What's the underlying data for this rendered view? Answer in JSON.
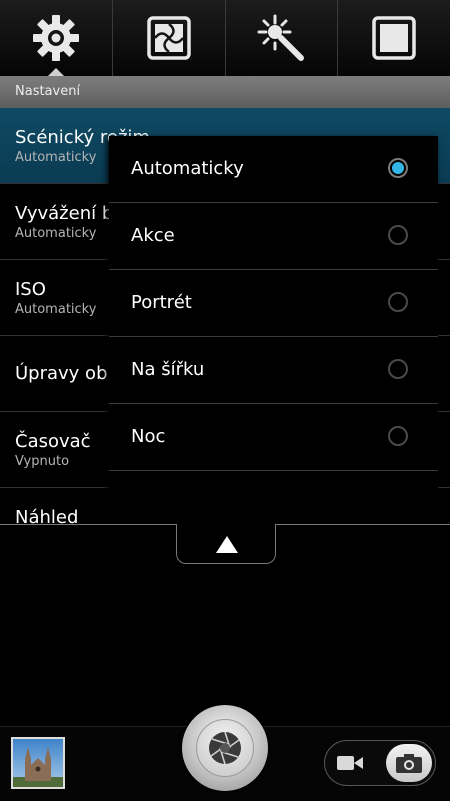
{
  "tabs": [
    {
      "icon": "gear-icon",
      "active": true
    },
    {
      "icon": "effects-grid-icon",
      "active": false
    },
    {
      "icon": "magic-wand-icon",
      "active": false
    },
    {
      "icon": "square-icon",
      "active": false
    }
  ],
  "section_header": "Nastavení",
  "settings": [
    {
      "title": "Scénický režim",
      "value": "Automaticky"
    },
    {
      "title": "Vyvážení bílé",
      "value": "Automaticky"
    },
    {
      "title": "ISO",
      "value": "Automaticky"
    },
    {
      "title": "Úpravy obrázku",
      "value": ""
    },
    {
      "title": "Časovač",
      "value": "Vypnuto"
    },
    {
      "title": "Náhled",
      "value": ""
    }
  ],
  "dropdown": {
    "options": [
      {
        "label": "Automaticky",
        "checked": true
      },
      {
        "label": "Akce",
        "checked": false
      },
      {
        "label": "Portrét",
        "checked": false
      },
      {
        "label": "Na šířku",
        "checked": false
      },
      {
        "label": "Noc",
        "checked": false
      }
    ]
  },
  "bottom_bar": {
    "thumbnail": "gallery-thumbnail-icon",
    "shutter": "shutter-aperture-icon",
    "mode_video": "video-camera-icon",
    "mode_photo": "photo-camera-icon",
    "active_mode": "photo"
  },
  "colors": {
    "accent": "#33b5e5",
    "selected_row": "#0f4a64",
    "header_bg": "#6e6e6e"
  }
}
